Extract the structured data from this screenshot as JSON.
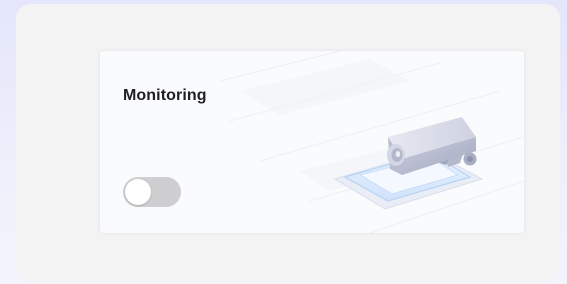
{
  "monitoring_card": {
    "title": "Monitoring",
    "toggle": {
      "state": "off"
    },
    "illustration_icon": "security-camera-icon"
  },
  "colors": {
    "background": "#e4e6fb",
    "panel": "#f3f3f4",
    "card": "#fafbfd",
    "toggle_off": "#cfcfd2",
    "title_text": "#1f1f24"
  }
}
